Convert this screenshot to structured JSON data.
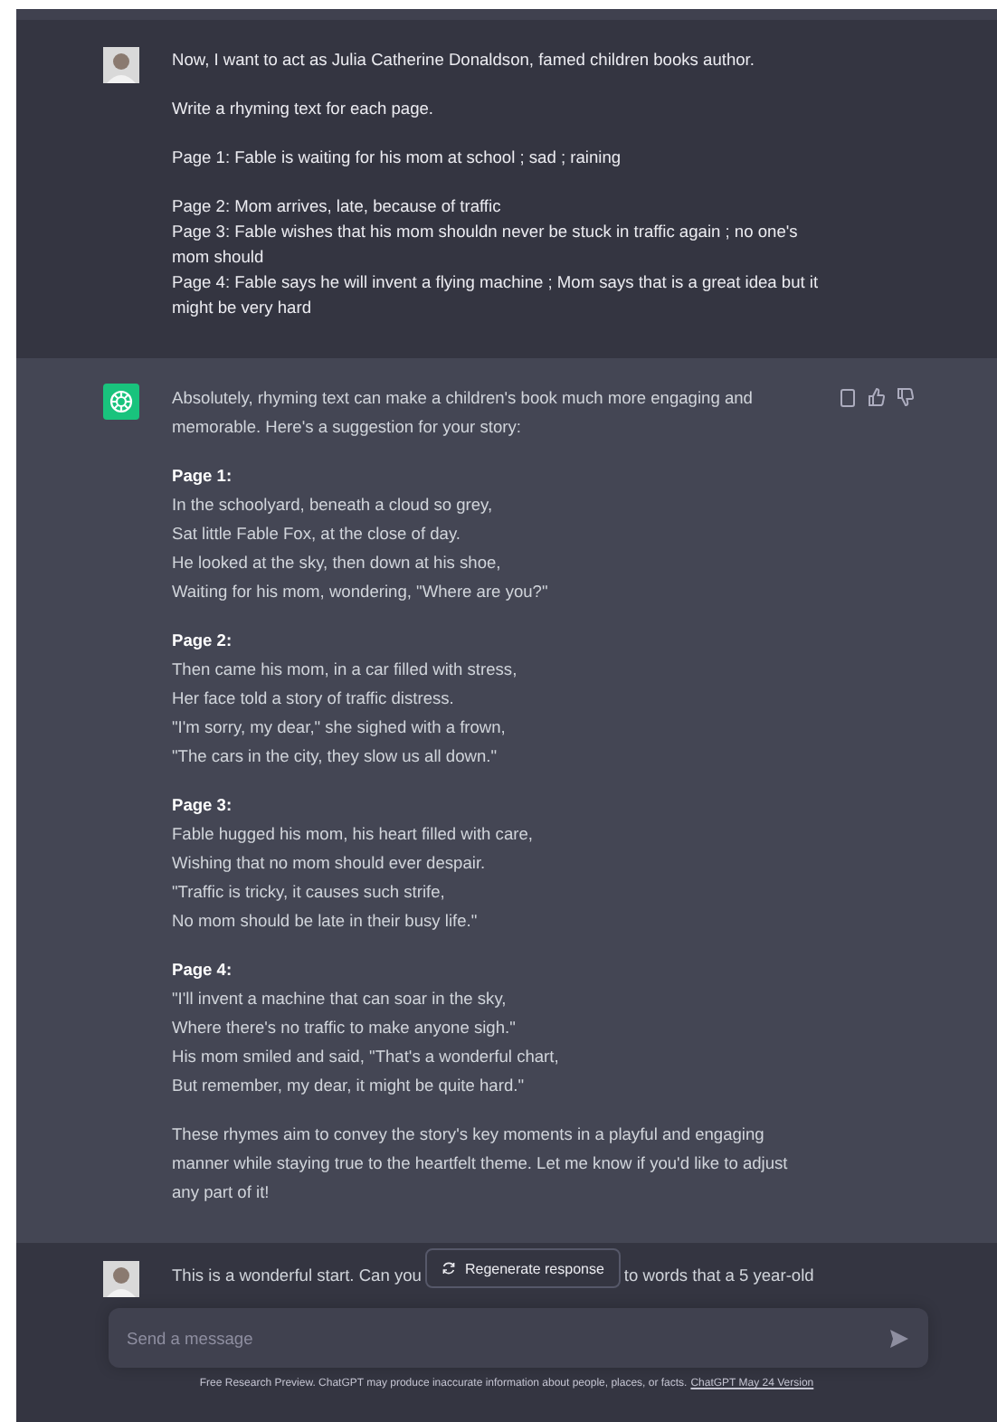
{
  "user_message": {
    "paragraphs": [
      {
        "lines": [
          "Now, I want to act as Julia Catherine Donaldson, famed children books author."
        ]
      },
      {
        "lines": [
          "Write a rhyming text for each page."
        ]
      },
      {
        "lines": [
          "Page 1: Fable is waiting for his mom at school ; sad ; raining"
        ]
      },
      {
        "lines": [
          "Page 2: Mom arrives, late, because of traffic",
          "Page 3: Fable wishes that his mom shouldn never be stuck in traffic again ; no one's mom should",
          "Page 4: Fable says he will invent a flying machine ; Mom says that is a great idea but it might be very hard"
        ]
      }
    ]
  },
  "assistant_message": {
    "intro": "Absolutely, rhyming text can make a children's book much more engaging and memorable. Here's a suggestion for your story:",
    "stanzas": [
      {
        "heading": "Page 1:",
        "lines": [
          "In the schoolyard, beneath a cloud so grey,",
          "Sat little Fable Fox, at the close of day.",
          "He looked at the sky, then down at his shoe,",
          "Waiting for his mom, wondering, \"Where are you?\""
        ]
      },
      {
        "heading": "Page 2:",
        "lines": [
          "Then came his mom, in a car filled with stress,",
          "Her face told a story of traffic distress.",
          "\"I'm sorry, my dear,\" she sighed with a frown,",
          "\"The cars in the city, they slow us all down.\""
        ]
      },
      {
        "heading": "Page 3:",
        "lines": [
          "Fable hugged his mom, his heart filled with care,",
          "Wishing that no mom should ever despair.",
          "\"Traffic is tricky, it causes such strife,",
          "No mom should be late in their busy life.\""
        ]
      },
      {
        "heading": "Page 4:",
        "lines": [
          "\"I'll invent a machine that can soar in the sky,",
          "Where there's no traffic to make anyone sigh.\"",
          "His mom smiled and said, \"That's a wonderful chart,",
          "But remember, my dear, it might be quite hard.\""
        ]
      }
    ],
    "outro": "These rhymes aim to convey the story's key moments in a playful and engaging manner while staying true to the heartfelt theme. Let me know if you'd like to adjust any part of it!"
  },
  "next_message": {
    "text_before": "This is a wonderful start. Can you",
    "text_after": "to words that a 5 year-old"
  },
  "regenerate_button": {
    "label": "Regenerate response"
  },
  "composer": {
    "placeholder": "Send a message"
  },
  "footer": {
    "text": "Free Research Preview. ChatGPT may produce inaccurate information about people, places, or facts.",
    "link": "ChatGPT May 24 Version"
  }
}
